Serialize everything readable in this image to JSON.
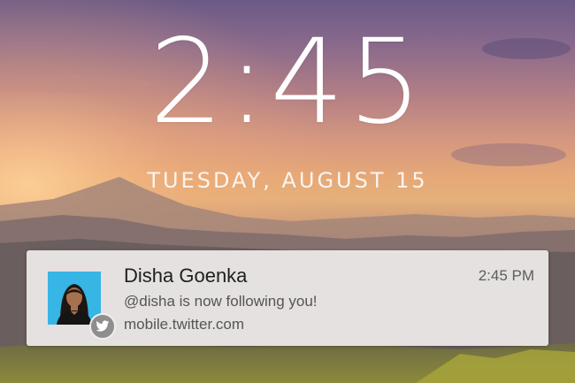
{
  "lockscreen": {
    "time": "2:45",
    "date": "TUESDAY, AUGUST 15"
  },
  "notification": {
    "sender": "Disha Goenka",
    "time": "2:45 PM",
    "message": "@disha is now following you!",
    "source": "mobile.twitter.com",
    "app_icon": "twitter-bird-icon",
    "avatar_background": "#37b5e4"
  },
  "colors": {
    "card_background": "#eeeceb",
    "clock_text": "#ffffff"
  }
}
